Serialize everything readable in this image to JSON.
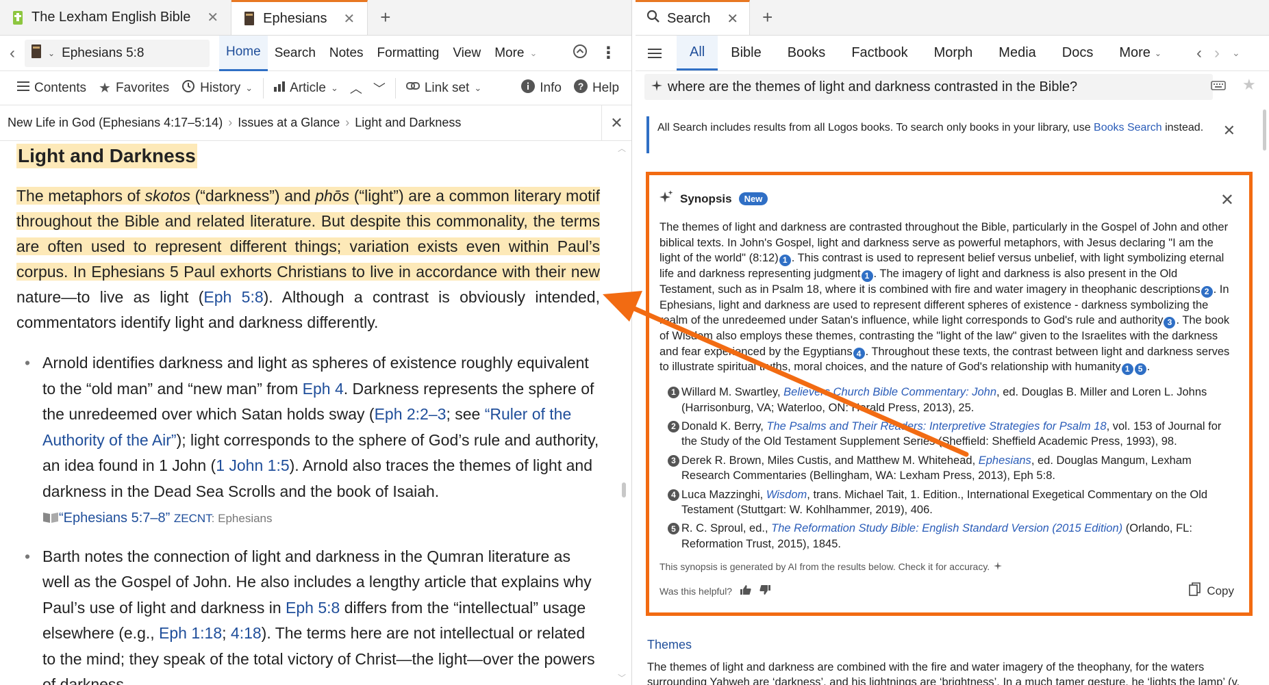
{
  "left": {
    "tabs": [
      {
        "label": "The Lexham English Bible",
        "active": false
      },
      {
        "label": "Ephesians",
        "active": true
      }
    ],
    "reference": "Ephesians 5:8",
    "nav_tabs": [
      "Home",
      "Search",
      "Notes",
      "Formatting",
      "View",
      "More"
    ],
    "toolbar": {
      "contents": "Contents",
      "favorites": "Favorites",
      "history": "History",
      "article": "Article",
      "link_set": "Link set",
      "info": "Info",
      "help": "Help"
    },
    "breadcrumb": [
      "New Life in God (Ephesians 4:17–5:14)",
      "Issues at a Glance",
      "Light and Darkness"
    ],
    "article": {
      "heading": "Light and Darkness",
      "p1_a": "The metaphors of ",
      "p1_skotos": "skotos",
      "p1_b": " (“darkness”) and ",
      "p1_phos": "phōs",
      "p1_c": " (“light”) are a common literary motif throughout the Bible and related literature. But despite this commonality, the terms are often used to represent different things; variation exists even within Paul’s corpus. In Ephesians 5 Paul exhorts Christians to live in accordance with their new",
      "p1_d": " nature—to live as light (",
      "p1_link": "Eph 5:8",
      "p1_e": "). Although a contrast is obviously intended, commentators identify light and darkness differently.",
      "b1_a": "Arnold identifies darkness and light as spheres of existence roughly equivalent to the “old man” and “new man” from ",
      "b1_eph4": "Eph 4",
      "b1_b": ". Darkness represents the sphere of the unredeemed over which Satan holds sway (",
      "b1_eph22": "Eph 2:2–3",
      "b1_c": "; see ",
      "b1_ruler": "“Ruler of the Authority of the Air”",
      "b1_d": "); light corresponds to the sphere of God’s rule and authority, an idea found in 1 John (",
      "b1_john": "1 John 1:5",
      "b1_e": "). Arnold also traces the themes of light and darkness in the Dead Sea Scrolls and the book of Isaiah.",
      "b1_source": "“Ephesians 5:7–8”",
      "b1_abbr": "ZECNT",
      "b1_srcname": ": Ephesians",
      "b2_a": "Barth notes the connection of light and darkness in the Qumran literature as well as the Gospel of John. He also includes a lengthy article that explains why Paul’s use of light and darkness in ",
      "b2_eph58": "Eph 5:8",
      "b2_b": " differs from the “intellectual” usage elsewhere (e.g., ",
      "b2_eph118": "Eph 1:18",
      "b2_c": "; ",
      "b2_418": "4:18",
      "b2_d": "). The terms here are not intellectual or related to the mind; they speak of the total victory of Christ—the light—over the powers of darkness."
    }
  },
  "right": {
    "tab_label": "Search",
    "categories": [
      "All",
      "Bible",
      "Books",
      "Factbook",
      "Morph",
      "Media",
      "Docs",
      "More"
    ],
    "query": "where are the themes of light and darkness contrasted in the Bible?",
    "notice_a": "All Search includes results from all Logos books. To search only books in your library, use ",
    "notice_link": "Books Search",
    "notice_b": " instead.",
    "synopsis": {
      "title": "Synopsis",
      "badge": "New",
      "t1": "The themes of light and darkness are contrasted throughout the Bible, particularly in the Gospel of John and other biblical texts. In John's Gospel, light and darkness serve as powerful metaphors, with Jesus declaring \"I am the light of the world\" (8:12)",
      "t2": ". This contrast is used to represent belief versus unbelief, with light symbolizing eternal life and darkness representing judgment",
      "t3": ". The imagery of light and darkness is also present in the Old Testament, such as in Psalm 18, where it is combined with fire and water imagery in theophanic descriptions",
      "t4": ". In Ephesians, light and darkness are used to represent different spheres of existence - darkness symbolizing the realm of the unredeemed under Satan's influence, while light corresponds to God's rule and authority",
      "t5": ". The book of Wisdom also employs these themes, contrasting the \"light of the law\" given to the Israelites with the darkness and fear experienced by the Egyptians",
      "t6": ". Throughout these texts, the contrast between light and darkness serves to illustrate spiritual truths, moral choices, and the nature of God's relationship with humanity",
      "refs": [
        {
          "n": "1",
          "a": "Willard M. Swartley, ",
          "title": "Believers Church Bible Commentary: John",
          "b": ", ed. Douglas B. Miller and Loren L. Johns (Harrisonburg, VA; Waterloo, ON: Herald Press, 2013), 25."
        },
        {
          "n": "2",
          "a": "Donald K. Berry, ",
          "title": "The Psalms and Their Readers: Interpretive Strategies for Psalm 18",
          "b": ", vol. 153 of Journal for the Study of the Old Testament Supplement Series (Sheffield: Sheffield Academic Press, 1993), 98."
        },
        {
          "n": "3",
          "a": "Derek R. Brown, Miles Custis, and Matthew M. Whitehead, ",
          "title": "Ephesians",
          "b": ", ed. Douglas Mangum, Lexham Research Commentaries (Bellingham, WA: Lexham Press, 2013), Eph 5:8."
        },
        {
          "n": "4",
          "a": "Luca Mazzinghi, ",
          "title": "Wisdom",
          "b": ", trans. Michael Tait, 1. Edition., International Exegetical Commentary on the Old Testament (Stuttgart: W. Kohlhammer, 2019), 406."
        },
        {
          "n": "5",
          "a": "R. C. Sproul, ed., ",
          "title": "The Reformation Study Bible: English Standard Version (2015 Edition)",
          "b": " (Orlando, FL: Reformation Trust, 2015), 1845."
        }
      ],
      "disclaimer": "This synopsis is generated by AI from the results below. Check it for accuracy.",
      "helpful": "Was this helpful?",
      "copy": "Copy"
    },
    "themes_label": "Themes",
    "themes_text": "The themes of light and darkness are combined with the fire and water imagery of the theophany, for the waters surrounding Yahweh are ‘darkness’, and his lightnings are ‘brightness’. In a much tamer gesture, he ‘lights the lamp’ (v."
  },
  "accent_color": "#f26b12",
  "link_color": "#1f4e9a",
  "highlight_color": "#fde9b8"
}
